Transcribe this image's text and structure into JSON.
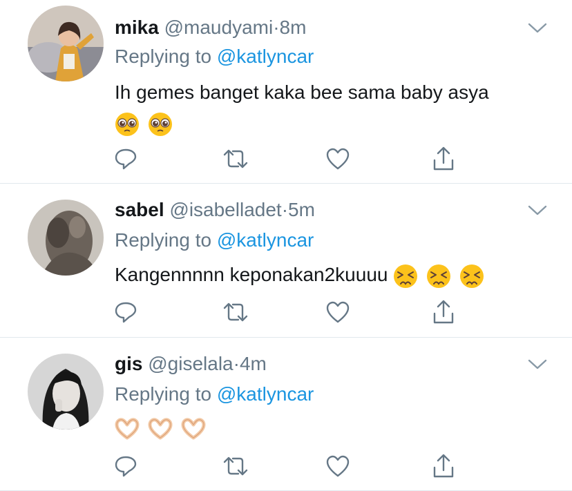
{
  "colors": {
    "text": "#14171a",
    "secondary": "#657786",
    "link": "#1b95e0",
    "divider": "#e1e8ed"
  },
  "replying_label": "Replying to",
  "tweets": [
    {
      "name": "mika",
      "handle": "@maudyami",
      "sep": "·",
      "time": "8m",
      "mention": "@katlyncar",
      "text": "Ih gemes banget kaka bee sama baby asya",
      "emojis": [
        "pleading-face",
        "pleading-face"
      ]
    },
    {
      "name": "sabel",
      "handle": "@isabelladet",
      "sep": "·",
      "time": "5m",
      "mention": "@katlyncar",
      "text": "Kangennnnn keponakan2kuuuu",
      "emojis": [
        "persevering-face",
        "persevering-face",
        "persevering-face"
      ]
    },
    {
      "name": "gis",
      "handle": "@giselala",
      "sep": "·",
      "time": "4m",
      "mention": "@katlyncar",
      "text": "",
      "emojis": [
        "heart-hands",
        "heart-hands",
        "heart-hands"
      ]
    }
  ],
  "action_icons": [
    "reply-icon",
    "retweet-icon",
    "like-icon",
    "share-icon"
  ]
}
